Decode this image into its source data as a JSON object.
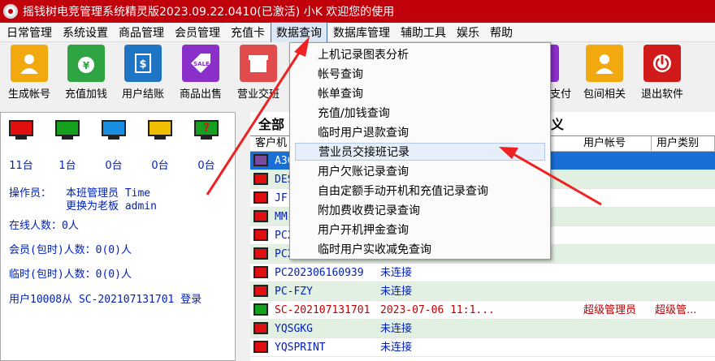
{
  "window": {
    "title": "摇钱树电竞管理系统精灵版2023.09.22.0410(已激活)  小K 欢迎您的使用"
  },
  "menu": [
    "日常管理",
    "系统设置",
    "商品管理",
    "会员管理",
    "充值卡",
    "数据查询",
    "数据库管理",
    "辅助工具",
    "娱乐",
    "帮助"
  ],
  "toolbar": [
    "生成帐号",
    "充值加钱",
    "用户结账",
    "商品出售",
    "营业交班",
    "支付",
    "包间相关",
    "退出软件"
  ],
  "colors": {
    "titlebar": "#c0000a",
    "link_blue": "#0020c0",
    "offline_row": "#e2f0e2"
  },
  "status": {
    "counts": [
      "11台",
      "1台",
      "0台",
      "0台",
      "0台"
    ],
    "operator_label": "操作员：",
    "operator_value": "本班管理员 Time",
    "operator_change": "更换为老板 admin",
    "online": "在线人数：0人",
    "members": "会员(包时)人数：0(0)人",
    "temps": "临时(包时)人数：0(0)人",
    "login_msg": "用户10008从 SC-202107131701 登录"
  },
  "list": {
    "tab_all": "全部",
    "tab_custom": "义",
    "headers": [
      "客户机",
      "用户帐号",
      "用户类别"
    ],
    "rows": [
      {
        "name": "A3C",
        "state": "",
        "account": "",
        "type": ""
      },
      {
        "name": "DES",
        "state": "",
        "account": "",
        "type": ""
      },
      {
        "name": "JF",
        "state": "",
        "account": "",
        "type": ""
      },
      {
        "name": "MM-",
        "state": "",
        "account": "",
        "type": ""
      },
      {
        "name": "PC2",
        "state": "",
        "account": "",
        "type": ""
      },
      {
        "name": "PC2",
        "state": "",
        "account": "",
        "type": ""
      },
      {
        "name": "PC202306160939",
        "state": "未连接",
        "account": "",
        "type": ""
      },
      {
        "name": "PC-FZY",
        "state": "未连接",
        "account": "",
        "type": ""
      },
      {
        "name": "SC-202107131701",
        "state": "2023-07-06 11:1...",
        "account": "超级管理员",
        "type": "超级管..."
      },
      {
        "name": "YQSGKG",
        "state": "未连接",
        "account": "",
        "type": ""
      },
      {
        "name": "YQSPRINT",
        "state": "未连接",
        "account": "",
        "type": ""
      }
    ]
  },
  "dropdown": [
    "上机记录图表分析",
    "帐号查询",
    "帐单查询",
    "充值/加钱查询",
    "临时用户退款查询",
    "营业员交接班记录",
    "用户欠账记录查询",
    "自由定额手动开机和充值记录查询",
    "附加费收费记录查询",
    "用户开机押金查询",
    "临时用户实收减免查询"
  ]
}
